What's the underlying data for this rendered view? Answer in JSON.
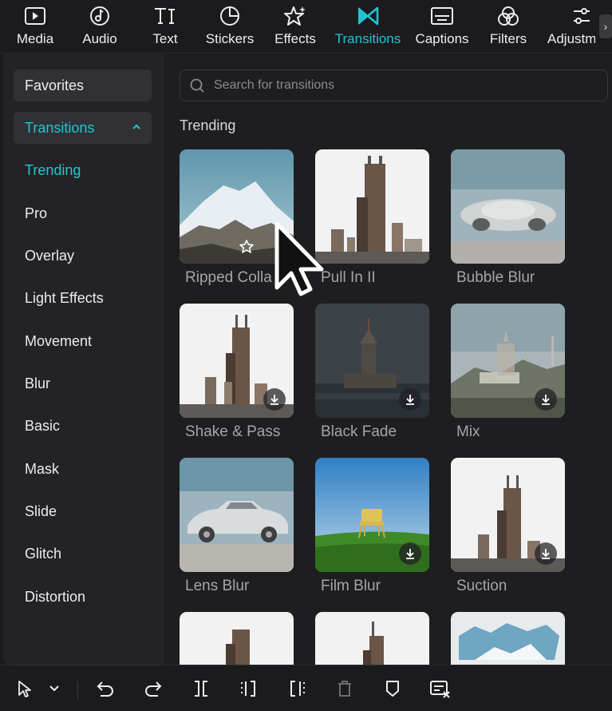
{
  "toolbar": {
    "items": [
      {
        "label": "Media",
        "icon": "media-icon"
      },
      {
        "label": "Audio",
        "icon": "audio-icon"
      },
      {
        "label": "Text",
        "icon": "text-icon"
      },
      {
        "label": "Stickers",
        "icon": "stickers-icon"
      },
      {
        "label": "Effects",
        "icon": "effects-icon"
      },
      {
        "label": "Transitions",
        "icon": "transitions-icon",
        "active": true
      },
      {
        "label": "Captions",
        "icon": "captions-icon"
      },
      {
        "label": "Filters",
        "icon": "filters-icon"
      },
      {
        "label": "Adjustm",
        "icon": "adjustment-icon"
      }
    ],
    "more_icon": "chevron-right-icon"
  },
  "sidebar": {
    "favorites": "Favorites",
    "group": "Transitions",
    "items": [
      "Trending",
      "Pro",
      "Overlay",
      "Light Effects",
      "Movement",
      "Blur",
      "Basic",
      "Mask",
      "Slide",
      "Glitch",
      "Distortion"
    ],
    "active_item": "Trending"
  },
  "search": {
    "placeholder": "Search for transitions",
    "value": ""
  },
  "section_title": "Trending",
  "transitions": [
    {
      "label": "Ripped Colla",
      "thumb": "mountain"
    },
    {
      "label": "Pull In II",
      "thumb": "tower"
    },
    {
      "label": "Bubble Blur",
      "thumb": "blurcar"
    },
    {
      "label": "Shake & Pass",
      "thumb": "tower"
    },
    {
      "label": "Black Fade",
      "thumb": "lighthouse"
    },
    {
      "label": "Mix",
      "thumb": "hollywood"
    },
    {
      "label": "Lens Blur",
      "thumb": "car"
    },
    {
      "label": "Film Blur",
      "thumb": "chair"
    },
    {
      "label": "Suction",
      "thumb": "tower"
    },
    {
      "label": "",
      "thumb": "tower"
    },
    {
      "label": "",
      "thumb": "tower"
    },
    {
      "label": "",
      "thumb": "ripped"
    }
  ],
  "colors": {
    "accent": "#21c5d0",
    "panel": "#232326",
    "background": "#1b1b1d"
  },
  "bottom_toolbar": [
    "select-pointer-icon",
    "dropdown-chevron-icon",
    "undo-icon",
    "redo-icon",
    "split-icon",
    "split-left-icon",
    "split-right-icon",
    "delete-icon",
    "marker-icon",
    "caption-edit-icon"
  ]
}
